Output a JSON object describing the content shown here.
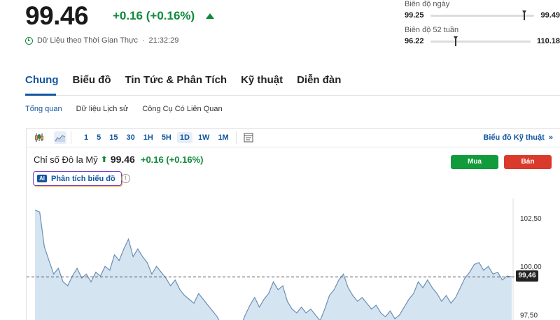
{
  "quote": {
    "price": "99.46",
    "change": "+0.16 (+0.16%)",
    "realtime_label": "Dữ Liệu theo Thời Gian Thực",
    "separator": "·",
    "time": "21:32:29",
    "change_color": "#0f8a3a"
  },
  "day_range": {
    "label": "Biên độ ngày",
    "low": "99.25",
    "high": "99.49",
    "position": 0.88
  },
  "week52_range": {
    "label": "Biên độ 52 tuần",
    "low": "96.22",
    "high": "110.18",
    "position": 0.23
  },
  "main_tabs": [
    {
      "label": "Chung",
      "active": true
    },
    {
      "label": "Biểu đồ"
    },
    {
      "label": "Tin Tức & Phân Tích"
    },
    {
      "label": "Kỹ thuật"
    },
    {
      "label": "Diễn đàn"
    }
  ],
  "sub_tabs": [
    {
      "label": "Tổng quan",
      "active": true
    },
    {
      "label": "Dữ liệu Lịch sử"
    },
    {
      "label": "Công Cụ Có Liên Quan"
    }
  ],
  "toolbar": {
    "icons": [
      "candlestick-icon",
      "area-chart-icon",
      "indicator-icon"
    ],
    "timeframes": [
      "1",
      "5",
      "15",
      "30",
      "1H",
      "5H",
      "1D",
      "1W",
      "1M"
    ],
    "active_timeframe": "1D",
    "tech_link": "Biểu đồ Kỹ thuật",
    "tech_link_suffix": "»"
  },
  "instrument": {
    "name": "Chỉ số Đô la Mỹ",
    "arrow": "⬆",
    "value": "99.46",
    "change": "+0.16 (+0.16%)"
  },
  "buttons": {
    "buy": "Mua",
    "sell": "Bán",
    "buy_color": "#119b3a",
    "sell_color": "#d93a2b"
  },
  "ai": {
    "badge": "AI",
    "label": "Phân tích biểu đồ",
    "info": "i"
  },
  "chart_data": {
    "type": "area",
    "y_ticks": [
      "102,50",
      "100,00",
      "97,50"
    ],
    "ylim": [
      97.2,
      103.5
    ],
    "current_price_label": "99,46",
    "current_price": 99.46,
    "series_color": "#6a8fb5",
    "fill_color": "#d5e4f1",
    "values": [
      102.9,
      102.8,
      101.0,
      100.3,
      99.6,
      99.9,
      99.2,
      99.0,
      99.5,
      99.9,
      99.4,
      99.6,
      99.2,
      99.7,
      99.5,
      100.0,
      99.8,
      100.6,
      100.3,
      100.9,
      101.4,
      100.5,
      100.9,
      100.5,
      100.2,
      99.6,
      100.0,
      99.7,
      99.4,
      99.0,
      99.3,
      98.8,
      98.5,
      98.3,
      98.1,
      98.6,
      98.3,
      98.0,
      97.7,
      97.4,
      96.9,
      97.2,
      96.8,
      96.5,
      96.9,
      97.5,
      98.0,
      98.4,
      97.9,
      98.3,
      98.6,
      99.2,
      98.8,
      99.0,
      98.2,
      97.8,
      97.6,
      97.9,
      97.6,
      97.8,
      97.5,
      97.2,
      97.8,
      98.5,
      98.8,
      99.3,
      99.6,
      98.9,
      98.5,
      98.2,
      98.4,
      98.1,
      97.8,
      98.0,
      97.6,
      97.4,
      97.7,
      97.3,
      97.5,
      97.9,
      98.3,
      98.6,
      99.2,
      98.9,
      99.3,
      98.9,
      98.6,
      98.2,
      98.5,
      98.1,
      98.4,
      98.9,
      99.4,
      99.7,
      100.1,
      100.2,
      99.8,
      100.0,
      99.6,
      99.7,
      99.3,
      99.5,
      99.46
    ]
  }
}
